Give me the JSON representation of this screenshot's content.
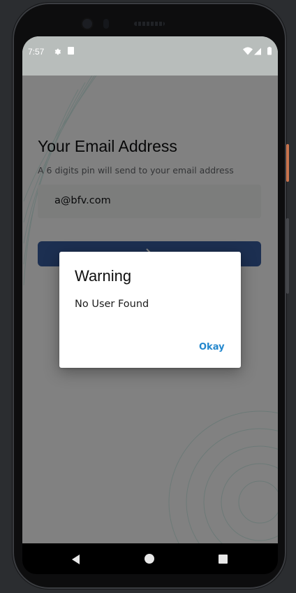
{
  "status_bar": {
    "time": "7:57",
    "left_icons": [
      "gear-icon",
      "sd-card-icon"
    ],
    "right_icons": [
      "wifi-icon",
      "signal-icon",
      "battery-icon"
    ]
  },
  "screen": {
    "title": "Your Email Address",
    "subtitle": "A 6 digits pin will send to your email address",
    "email_field": {
      "value": "a@bfv.com"
    },
    "submit_button": {
      "icon": "arrow-right-icon",
      "color": "#365a9c"
    }
  },
  "dialog": {
    "title": "Warning",
    "message": "No User Found",
    "action_label": "Okay",
    "action_color": "#2387cd"
  },
  "nav_bar": {
    "icons": [
      "back-icon",
      "home-icon",
      "recents-icon"
    ]
  },
  "colors": {
    "frame_background": "#2b2d30",
    "screen_background": "#f7f8f7",
    "dialog_background": "#ffffff"
  }
}
